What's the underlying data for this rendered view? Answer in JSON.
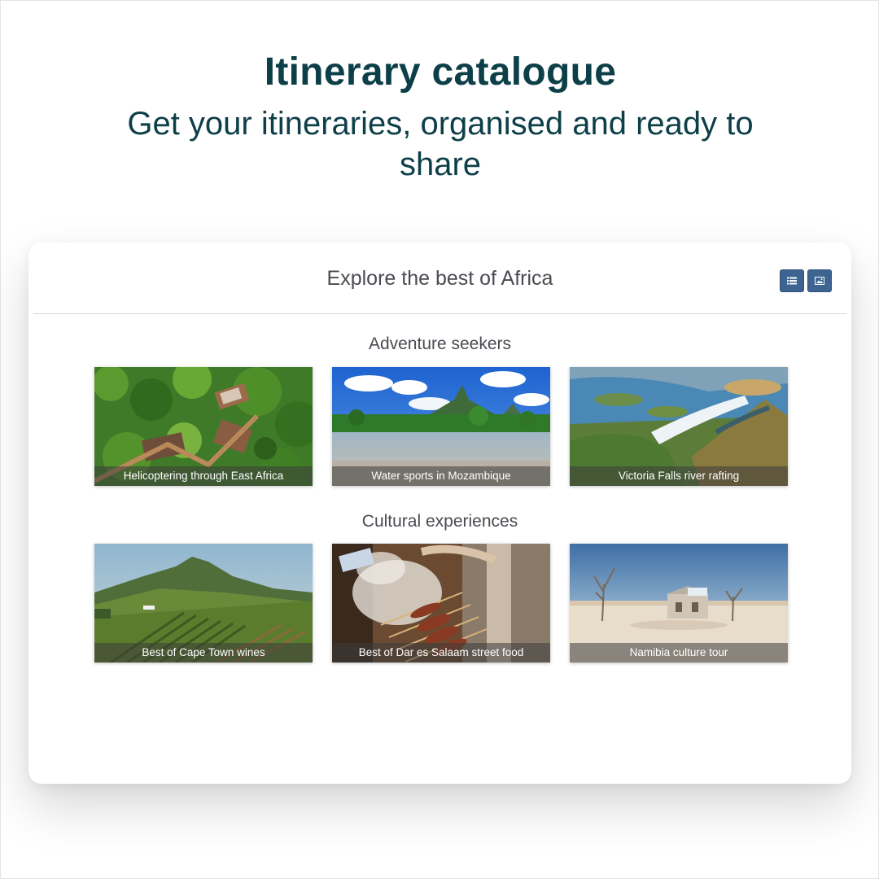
{
  "hero": {
    "title": "Itinerary catalogue",
    "subtitle": "Get your itineraries, organised and ready to share"
  },
  "catalogue": {
    "title": "Explore the best of Africa",
    "view_toggle": {
      "list_icon": "list-icon",
      "grid_icon": "image-icon",
      "button_color": "#3e6591"
    },
    "sections": [
      {
        "title": "Adventure seekers",
        "items": [
          {
            "caption": "Helicoptering through East Africa",
            "image": "aerial-forest-lodge"
          },
          {
            "caption": "Water sports in Mozambique",
            "image": "lake-and-mountain"
          },
          {
            "caption": "Victoria Falls river rafting",
            "image": "waterfall-gorge"
          }
        ]
      },
      {
        "title": "Cultural experiences",
        "items": [
          {
            "caption": "Best of Cape Town wines",
            "image": "vineyard-mountain"
          },
          {
            "caption": "Best of Dar es Salaam street food",
            "image": "grilled-skewers"
          },
          {
            "caption": "Namibia culture tour",
            "image": "desert-ruin"
          }
        ]
      }
    ]
  },
  "colors": {
    "heading": "#0d3f48",
    "section_text": "#4a4a52",
    "caption_bar": "rgba(60,60,60,0.55)"
  }
}
